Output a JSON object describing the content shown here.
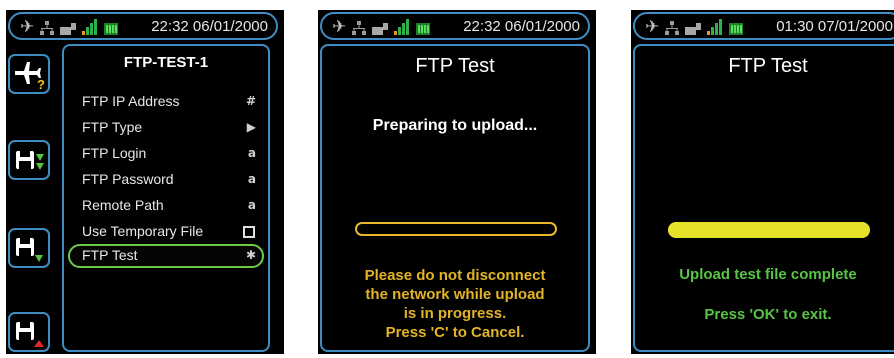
{
  "colors": {
    "background": "#000000",
    "frame_blue": "#3e8ec1",
    "selection_green": "#6ec94b",
    "warning_amber": "#e3b327",
    "progress_yellow": "#e7e12a",
    "success_green": "#57c444",
    "text_white": "#ffffff"
  },
  "status_icons": [
    "airplane-icon",
    "network-icon",
    "usb-icon",
    "signal-icon",
    "battery-icon"
  ],
  "screens": [
    {
      "status_time": "22:32 06/01/2000",
      "softkeys": [
        "airplane-help-icon",
        "save-down-icon",
        "save-icon",
        "save-up-icon"
      ],
      "menu": {
        "title": "FTP-TEST-1",
        "items": [
          {
            "label": "FTP IP Address",
            "indicator": "#",
            "indicator_icon": "hash-icon",
            "selected": false
          },
          {
            "label": "FTP Type",
            "indicator": "▶",
            "indicator_icon": "submenu-arrow-icon",
            "selected": false
          },
          {
            "label": "FTP Login",
            "indicator": "a",
            "indicator_icon": "text-entry-icon",
            "selected": false
          },
          {
            "label": "FTP Password",
            "indicator": "a",
            "indicator_icon": "text-entry-icon",
            "selected": false
          },
          {
            "label": "Remote Path",
            "indicator": "a",
            "indicator_icon": "text-entry-icon",
            "selected": false
          },
          {
            "label": "Use Temporary File",
            "indicator": "",
            "indicator_icon": "checkbox-icon",
            "checked": false,
            "selected": false
          },
          {
            "label": "FTP Test",
            "indicator": "✱",
            "indicator_icon": "action-gear-icon",
            "selected": true
          }
        ]
      }
    },
    {
      "status_time": "22:32 06/01/2000",
      "title": "FTP Test",
      "message": "Preparing to upload...",
      "progress": 0,
      "warning_lines": [
        "Please do not disconnect",
        "the network while upload",
        "is in progress.",
        "Press 'C' to Cancel."
      ]
    },
    {
      "status_time": "01:30 07/01/2000",
      "title": "FTP Test",
      "progress": 1,
      "complete_message": "Upload test file complete",
      "exit_message": "Press 'OK' to exit."
    }
  ]
}
